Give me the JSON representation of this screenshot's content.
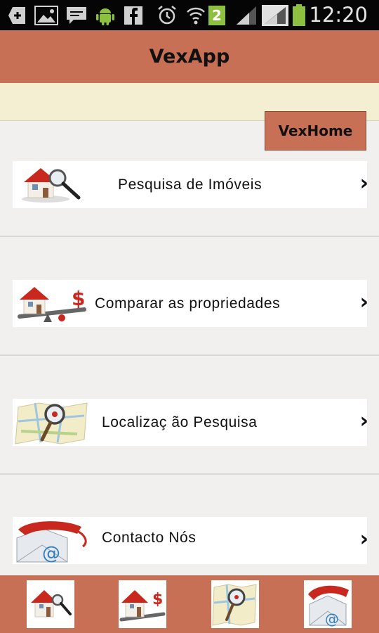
{
  "status_bar": {
    "time": "12:20",
    "notification_count": "2",
    "icons": [
      "add-icon",
      "image-icon",
      "message-icon",
      "android-icon",
      "facebook-icon",
      "alarm-icon",
      "wifi-icon",
      "notification-badge",
      "signal-icon",
      "signal-icon-2",
      "battery-icon"
    ]
  },
  "app": {
    "title": "VexApp",
    "home_button": "VexHome"
  },
  "menu": {
    "items": [
      {
        "label": "Pesquisa de Imóveis",
        "icon": "house-search-icon"
      },
      {
        "label": "Comparar as propriedades",
        "icon": "house-compare-icon"
      },
      {
        "label": "Localizaç   ão Pesquisa",
        "icon": "map-search-icon"
      },
      {
        "label": "Contacto Nós",
        "icon": "phone-mail-icon"
      }
    ],
    "chevron": "›"
  },
  "bottom_tabs": [
    {
      "icon": "house-search-icon"
    },
    {
      "icon": "house-compare-icon"
    },
    {
      "icon": "map-search-icon"
    },
    {
      "icon": "phone-mail-icon"
    }
  ],
  "colors": {
    "brand": "#c77056",
    "band": "#f4eed3",
    "background": "#f1f0ee"
  }
}
